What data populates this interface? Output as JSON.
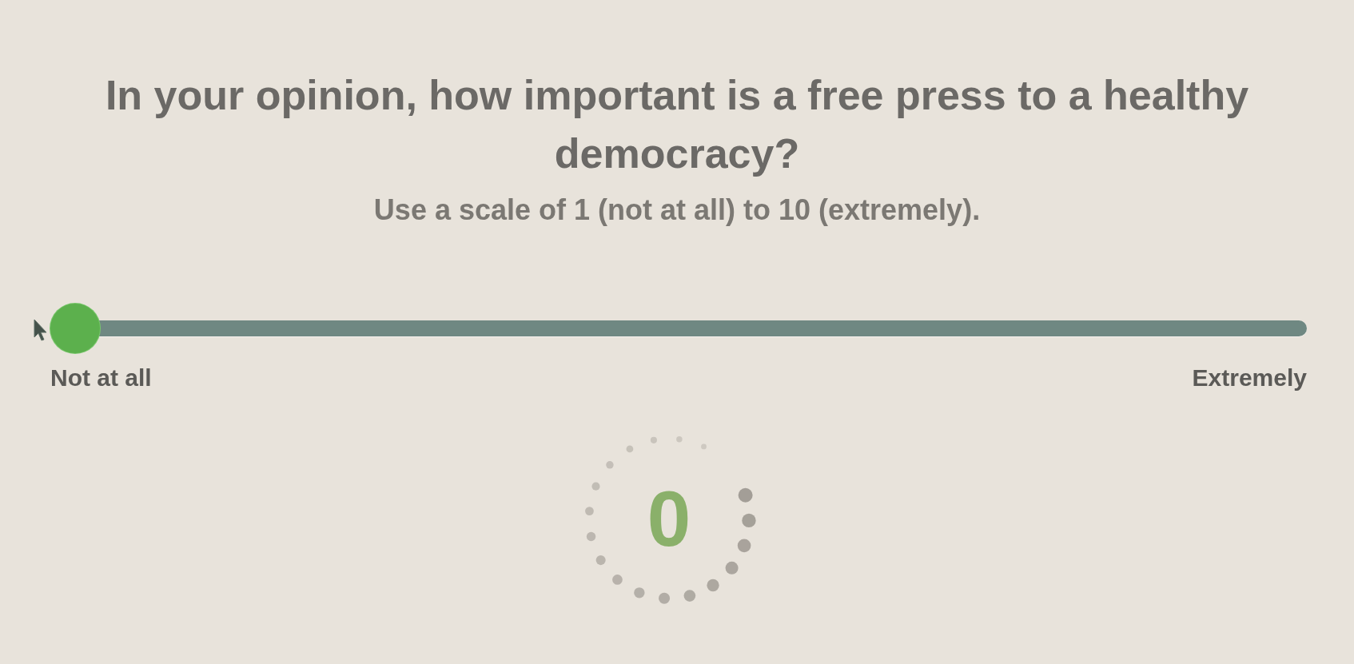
{
  "question": {
    "title": "In your opinion, how important is a free press to a healthy democracy?",
    "instruction": "Use a scale of 1 (not at all) to 10 (extremely)."
  },
  "scale": {
    "min_label": "Not at all",
    "max_label": "Extremely",
    "level": 0
  },
  "result": {
    "value": "0",
    "loading": true
  }
}
